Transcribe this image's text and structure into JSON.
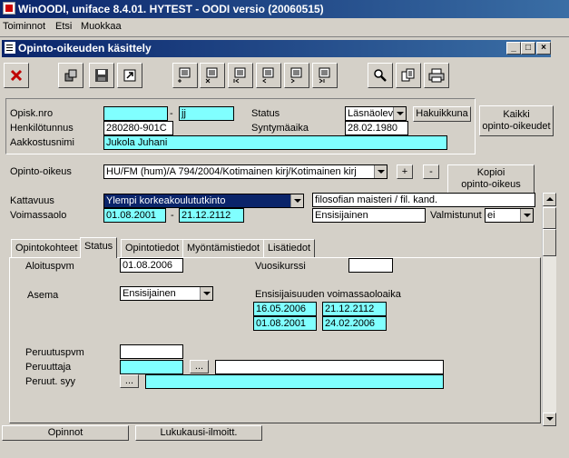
{
  "app": {
    "title": "WinOODI, uniface 8.4.01. HYTEST - OODI versio (20060515)"
  },
  "menu": [
    "Toiminnot",
    "Etsi",
    "Muokkaa"
  ],
  "window": {
    "title": "Opinto-oikeuden käsittely",
    "min": "_",
    "max": "□",
    "close": "×"
  },
  "toolbar": {
    "icons": [
      "close-x-icon",
      "copy-record-icon",
      "save-icon",
      "exit-icon",
      "doc-add-icon",
      "doc-delete-icon",
      "doc-first-icon",
      "doc-prev-icon",
      "doc-next-icon",
      "doc-last-icon",
      "search-icon",
      "copy-icon",
      "print-icon"
    ]
  },
  "header": {
    "opisk_nro_label": "Opisk.nro",
    "opisk_nro_value": "",
    "dash": "-",
    "opisk_nro_suffix": "jj",
    "status_label": "Status",
    "status_value": "Läsnäolev",
    "hakuikkuna": "Hakuikkuna",
    "kaikki_line1": "Kaikki",
    "kaikki_line2": "opinto-oikeudet",
    "henkilotunnus_label": "Henkilötunnus",
    "henkilotunnus_value": "280280-901C",
    "syntymaaika_label": "Syntymäaika",
    "syntymaaika_value": "28.02.1980",
    "aakkostusnimi_label": "Aakkostusnimi",
    "aakkostusnimi_value": "Jukola Juhani"
  },
  "oikeus": {
    "label": "Opinto-oikeus",
    "value": "HU/FM (hum)/A 794/2004/Kotimainen kirj/Kotimainen kirj",
    "plus": "+",
    "minus": "-",
    "kopioi_line1": "Kopioi",
    "kopioi_line2": "opinto-oikeus",
    "kattavuus_label": "Kattavuus",
    "kattavuus_value": "Ylempi korkeakoulututkinto",
    "tutkinto_value": "filosofian maisteri / fil. kand.",
    "voimassaolo_label": "Voimassaolo",
    "voimassa_from": "01.08.2001",
    "voimassa_to": "21.12.2112",
    "ensisijainen": "Ensisijainen",
    "valmistunut_label": "Valmistunut",
    "valmistunut_value": "ei"
  },
  "tabs": [
    "Opintokohteet",
    "Status",
    "Opintotiedot",
    "Myöntämistiedot",
    "Lisätiedot"
  ],
  "status_tab": {
    "aloituspvm_label": "Aloituspvm",
    "aloituspvm_value": "01.08.2006",
    "vuosikurssi_label": "Vuosikurssi",
    "vuosikurssi_value": "",
    "asema_label": "Asema",
    "asema_value": "Ensisijainen",
    "ensisijaisuus_label": "Ensisijaisuuden voimassaoloaika",
    "ens_rows": [
      {
        "from": "16.05.2006",
        "to": "21.12.2112"
      },
      {
        "from": "01.08.2001",
        "to": "24.02.2006"
      }
    ],
    "peruutuspvm_label": "Peruutuspvm",
    "peruuttaja_label": "Peruuttaja",
    "peruut_syy_label": "Peruut. syy",
    "ellipsis": "..."
  },
  "bottom": {
    "opinnot": "Opinnot",
    "lukukausi": "Lukukausi-ilmoitt."
  }
}
